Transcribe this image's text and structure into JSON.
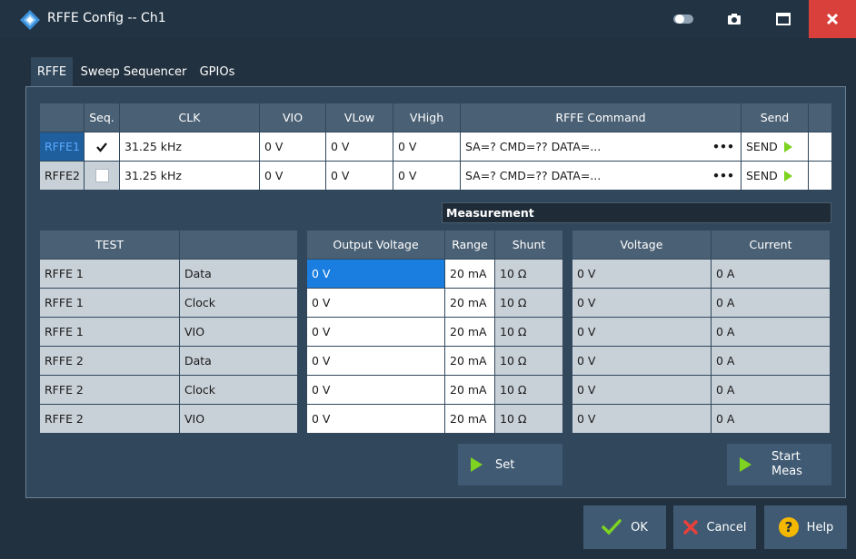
{
  "window": {
    "title": "RFFE Config -- Ch1"
  },
  "tabs": [
    {
      "label": "RFFE"
    },
    {
      "label": "Sweep Sequencer"
    },
    {
      "label": "GPIOs"
    }
  ],
  "top_table": {
    "headers": [
      "Seq.",
      "CLK",
      "VIO",
      "VLow",
      "VHigh",
      "RFFE Command",
      "Send"
    ],
    "rows": [
      {
        "label": "RFFE1",
        "seq_checked": true,
        "clk": "31.25 kHz",
        "vio": "0 V",
        "vlow": "0 V",
        "vhigh": "0 V",
        "command": "SA=? CMD=?? DATA=...",
        "more": "•••",
        "send": "SEND"
      },
      {
        "label": "RFFE2",
        "seq_checked": false,
        "clk": "31.25 kHz",
        "vio": "0 V",
        "vlow": "0 V",
        "vhigh": "0 V",
        "command": "SA=? CMD=?? DATA=...",
        "more": "•••",
        "send": "SEND"
      }
    ]
  },
  "measurement_label": "Measurement",
  "test_table": {
    "headers": [
      "TEST",
      ""
    ],
    "rows": [
      [
        "RFFE 1",
        "Data"
      ],
      [
        "RFFE 1",
        "Clock"
      ],
      [
        "RFFE 1",
        "VIO"
      ],
      [
        "RFFE 2",
        "Data"
      ],
      [
        "RFFE 2",
        "Clock"
      ],
      [
        "RFFE 2",
        "VIO"
      ]
    ]
  },
  "output_table": {
    "headers": [
      "Output Voltage",
      "Range",
      "Shunt"
    ],
    "rows": [
      [
        "0 V",
        "20 mA",
        "10 Ω"
      ],
      [
        "0 V",
        "20 mA",
        "10 Ω"
      ],
      [
        "0 V",
        "20 mA",
        "10 Ω"
      ],
      [
        "0 V",
        "20 mA",
        "10 Ω"
      ],
      [
        "0 V",
        "20 mA",
        "10 Ω"
      ],
      [
        "0 V",
        "20 mA",
        "10 Ω"
      ]
    ]
  },
  "meas_table": {
    "headers": [
      "Voltage",
      "Current"
    ],
    "rows": [
      [
        "0 V",
        "0 A"
      ],
      [
        "0 V",
        "0 A"
      ],
      [
        "0 V",
        "0 A"
      ],
      [
        "0 V",
        "0 A"
      ],
      [
        "0 V",
        "0 A"
      ],
      [
        "0 V",
        "0 A"
      ]
    ]
  },
  "buttons": {
    "set": "Set",
    "start_line1": "Start",
    "start_line2": "Meas",
    "ok": "OK",
    "cancel": "Cancel",
    "help": "Help"
  },
  "colors": {
    "accent_play": "#7ed321",
    "close_red": "#d9403b",
    "selected_blue": "#1a7ee0",
    "help_yellow": "#f5b800"
  }
}
